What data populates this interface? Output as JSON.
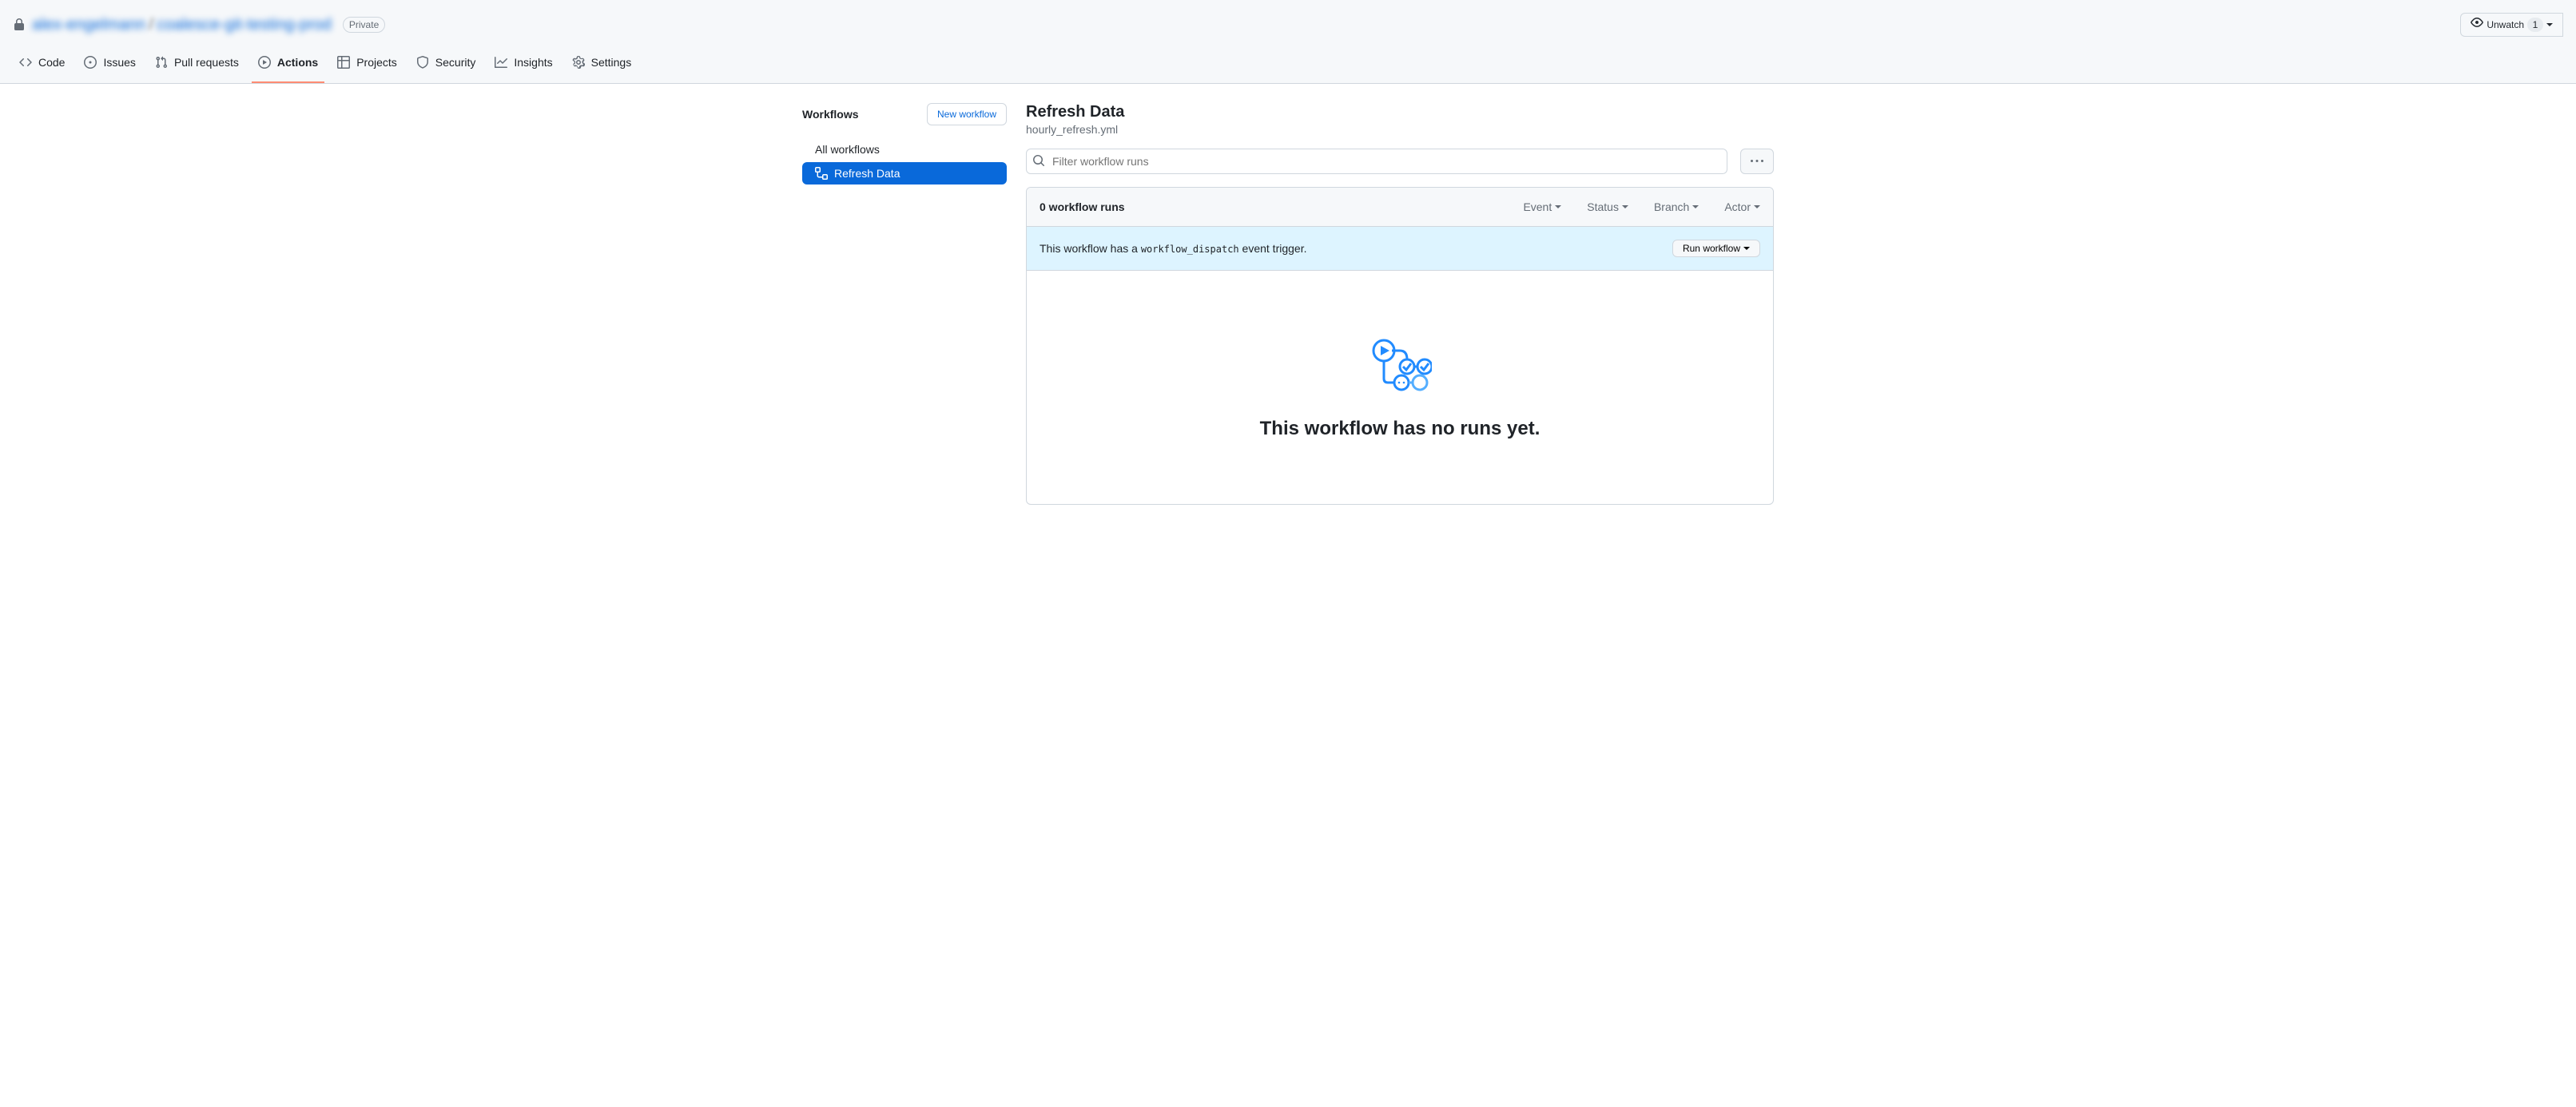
{
  "header": {
    "visibility_badge": "Private",
    "unwatch_label": "Unwatch",
    "unwatch_count": "1",
    "blurred_owner": "alex-engelmann",
    "blurred_repo": "coalesce-git-testing-prod"
  },
  "nav": {
    "code": "Code",
    "issues": "Issues",
    "pull_requests": "Pull requests",
    "actions": "Actions",
    "projects": "Projects",
    "security": "Security",
    "insights": "Insights",
    "settings": "Settings"
  },
  "sidebar": {
    "title": "Workflows",
    "new_workflow": "New workflow",
    "all_workflows": "All workflows",
    "items": [
      {
        "label": "Refresh Data"
      }
    ]
  },
  "page": {
    "title": "Refresh Data",
    "subtitle": "hourly_refresh.yml",
    "search_placeholder": "Filter workflow runs"
  },
  "runs": {
    "count_label": "0 workflow runs",
    "filters": {
      "event": "Event",
      "status": "Status",
      "branch": "Branch",
      "actor": "Actor"
    }
  },
  "dispatch": {
    "prefix": "This workflow has a ",
    "code": "workflow_dispatch",
    "suffix": " event trigger.",
    "run_button": "Run workflow"
  },
  "empty": {
    "title": "This workflow has no runs yet."
  }
}
